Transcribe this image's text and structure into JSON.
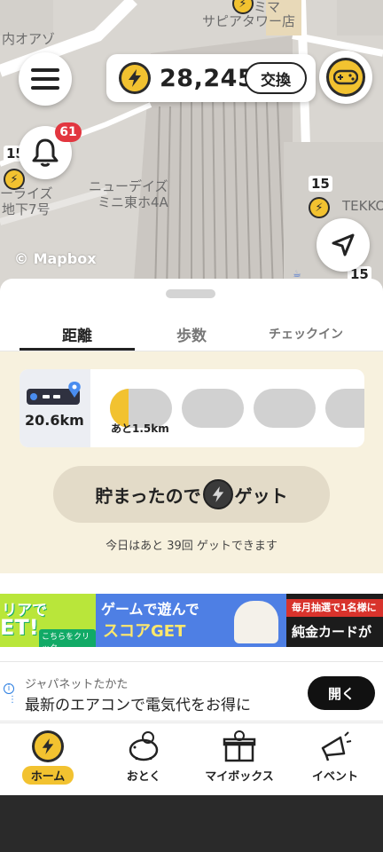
{
  "map": {
    "labels": {
      "top_left": "内オアゾ",
      "top_center_1": "ミマ",
      "top_center_2": "サピアタワー店",
      "left_mid_1": "ーライズ",
      "left_mid_2": "地下7号",
      "center_1": "ニューデイズ",
      "center_2": "ミニ東ホ4A",
      "right": "TEKKO"
    },
    "markers": {
      "left_count": "15",
      "right_count": "15",
      "bottom_right_count": "15"
    },
    "attribution": "© Mapbox"
  },
  "header": {
    "coin_count": "28,245",
    "exchange_label": "交換",
    "notification_count": "61"
  },
  "tabs": [
    {
      "label": "距離",
      "active": true
    },
    {
      "label": "歩数",
      "active": false
    },
    {
      "label": "チェックイン",
      "active": false
    }
  ],
  "distance": {
    "total": "20.6km",
    "first_slot_progress": 0.3,
    "remaining_text": "あと1.5km"
  },
  "collect": {
    "label_before": "貯まったので",
    "label_after": "ゲット",
    "note": "今日はあと 39回 ゲットできます"
  },
  "banner": {
    "left_fragment": "リアで",
    "left_fragment_2": "ET!",
    "left_small": "こちらをクリック",
    "center_line1": "ゲームで遊んで",
    "center_line2": "スコアGET",
    "right_line1": "毎月抽選で1名様に",
    "right_line2": "純金カードが"
  },
  "ad": {
    "sponsor": "ジャパネットたかた",
    "text": "最新のエアコンで電気代をお得に",
    "button": "開く"
  },
  "bottom_nav": [
    {
      "label": "ホーム",
      "icon": "bolt-coin-icon",
      "active": true
    },
    {
      "label": "おとく",
      "icon": "piggy-bank-icon",
      "active": false
    },
    {
      "label": "マイボックス",
      "icon": "gift-box-icon",
      "active": false
    },
    {
      "label": "イベント",
      "icon": "megaphone-icon",
      "active": false
    }
  ],
  "colors": {
    "accent": "#f2c230",
    "cream": "#f7f1de",
    "badge": "#e2363f"
  }
}
